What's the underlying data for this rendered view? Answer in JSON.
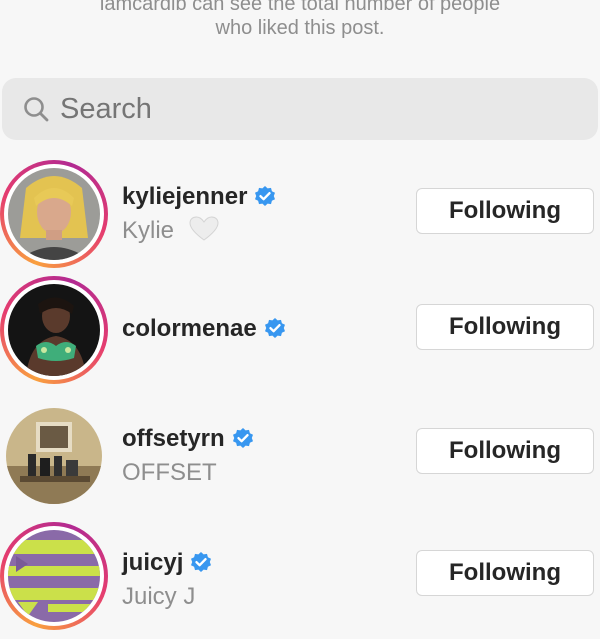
{
  "notice": {
    "line1": "iamcardib can see the total number of people",
    "line2": "who liked this post."
  },
  "search": {
    "placeholder": "Search",
    "icon": "search-icon"
  },
  "accounts": [
    {
      "username": "kyliejenner",
      "fullname": "Kylie",
      "fullname_suffix_icon": "white-heart-icon",
      "verified": true,
      "button": "Following",
      "has_story_ring": true
    },
    {
      "username": "colormenae",
      "fullname": "",
      "verified": true,
      "button": "Following",
      "has_story_ring": true
    },
    {
      "username": "offsetyrn",
      "fullname": "OFFSET",
      "verified": true,
      "button": "Following",
      "has_story_ring": false
    },
    {
      "username": "juicyj",
      "fullname": "Juicy J",
      "verified": true,
      "button": "Following",
      "has_story_ring": true
    }
  ],
  "colors": {
    "verified_blue": "#3897f0",
    "secondary_text": "#8e8e8e",
    "search_bg": "#e8e8e8"
  }
}
